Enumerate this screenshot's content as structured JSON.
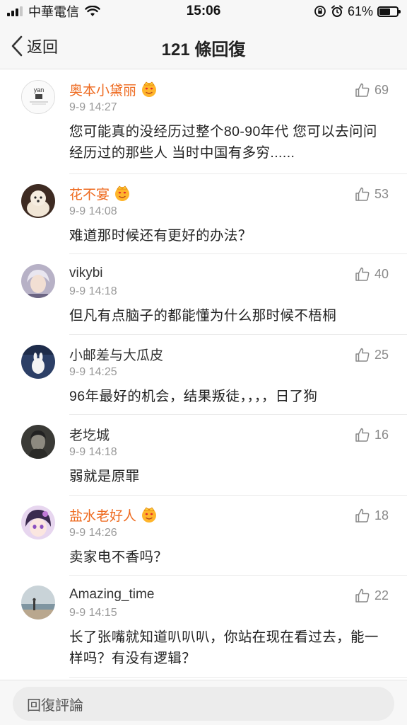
{
  "status_bar": {
    "carrier": "中華電信",
    "time": "15:06",
    "battery_percent": "61%",
    "battery_level": 0.61
  },
  "nav": {
    "back_label": "返回",
    "title": "121 條回復"
  },
  "comments": [
    {
      "username": "奥本小黛丽",
      "vip": true,
      "time": "9-9 14:27",
      "likes": "69",
      "text": "您可能真的没经历过整个80-90年代 您可以去问问经历过的那些人 当时中国有多穷......",
      "avatar_text": "yan"
    },
    {
      "username": "花不宴",
      "vip": true,
      "time": "9-9 14:08",
      "likes": "53",
      "text": "难道那时候还有更好的办法？"
    },
    {
      "username": "vikybi",
      "vip": false,
      "time": "9-9 14:18",
      "likes": "40",
      "text": "但凡有点脑子的都能懂为什么那时候不梧桐"
    },
    {
      "username": "小邮差与大瓜皮",
      "vip": false,
      "time": "9-9 14:25",
      "likes": "25",
      "text": "96年最好的机会，结果叛徒，，，，日了狗"
    },
    {
      "username": "老圪城",
      "vip": false,
      "time": "9-9 14:18",
      "likes": "16",
      "text": "弱就是原罪"
    },
    {
      "username": "盐水老好人",
      "vip": true,
      "time": "9-9 14:26",
      "likes": "18",
      "text": "卖家电不香吗？"
    },
    {
      "username": "Amazing_time",
      "vip": false,
      "time": "9-9 14:15",
      "likes": "22",
      "text": "长了张嘴就知道叭叭叭，你站在现在看过去，能一样吗？有没有逻辑？"
    }
  ],
  "reply_bar": {
    "placeholder": "回復評論"
  },
  "colors": {
    "vip_name": "#ee6a1f",
    "normal_name": "#333333",
    "meta": "#999999",
    "bar_bg": "#f7f7f7"
  }
}
